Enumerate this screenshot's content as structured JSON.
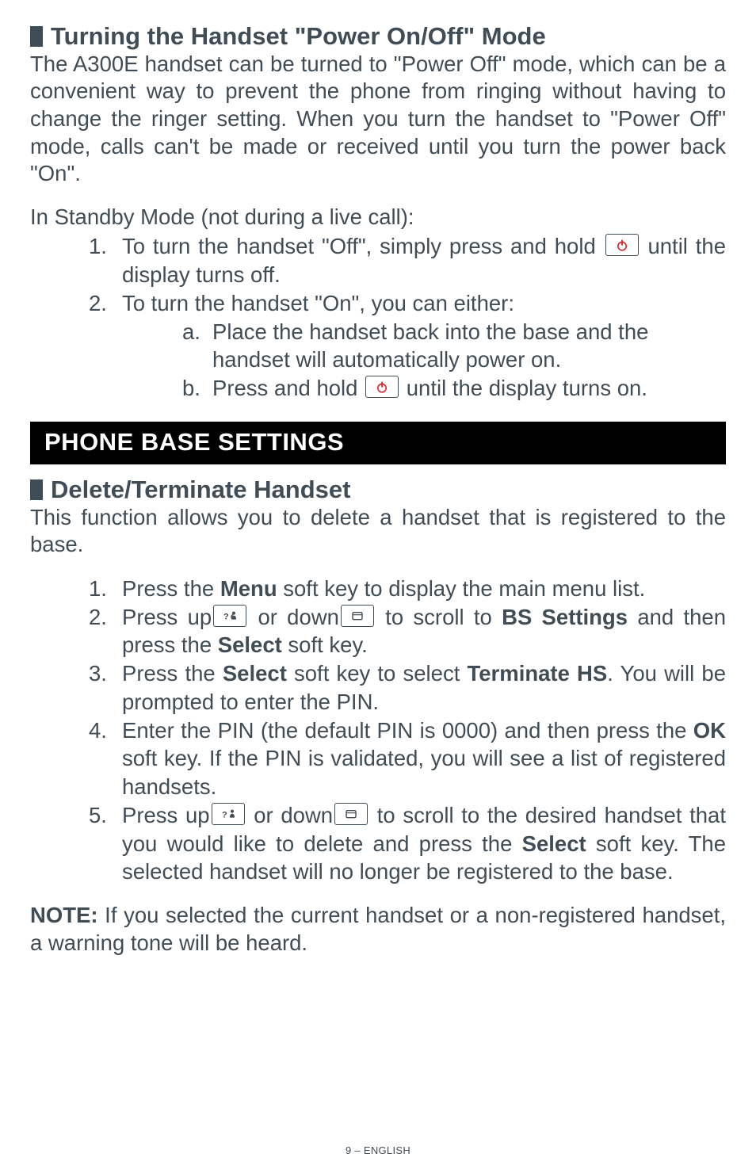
{
  "sec1": {
    "heading": "Turning the Handset \"Power On/Off\" Mode",
    "intro": "The A300E handset can be turned to \"Power Off\" mode, which can be a convenient way to prevent the phone from ringing without having to change the ringer setting.  When you turn the handset to \"Power Off\" mode, calls can't be made or received until you turn the power back \"On\".",
    "standby": "In Standby Mode (not during a live call):",
    "item1_num": "1.",
    "item1_pre": "To turn the handset \"Off\", simply press and hold ",
    "item1_post": " until the display turns off.",
    "item2_num": "2.",
    "item2_text": "To turn the handset \"On\", you can either:",
    "item2a_num": "a.",
    "item2a_text": "Place the handset back into the base and the handset will automatically power on.",
    "item2b_num": "b.",
    "item2b_pre": "Press and hold ",
    "item2b_post": " until the display turns on."
  },
  "bar": "PHONE BASE SETTINGS",
  "sec2": {
    "heading": "Delete/Terminate Handset",
    "intro": "This function allows you to delete a handset that is registered to the base.",
    "s1_num": "1.",
    "s1_a": "Press the ",
    "s1_b": "Menu",
    "s1_c": " soft key to display the main menu list.",
    "s2_num": "2.",
    "s2_a": "Press up",
    "s2_b": " or down",
    "s2_c": " to scroll to ",
    "s2_d": "BS Settings",
    "s2_e": " and then press the ",
    "s2_f": "Select",
    "s2_g": " soft key.",
    "s3_num": "3.",
    "s3_a": "Press the ",
    "s3_b": "Select",
    "s3_c": " soft key to select ",
    "s3_d": "Terminate HS",
    "s3_e": ".  You will be prompted to enter the PIN.",
    "s4_num": "4.",
    "s4_a": "Enter the PIN (the default PIN is 0000) and then press the ",
    "s4_b": "OK",
    "s4_c": " soft key.  If the PIN is validated, you will see a list of registered handsets.",
    "s5_num": "5.",
    "s5_a": "Press up",
    "s5_b": " or down",
    "s5_c": " to scroll to the desired handset that you would like to delete and press the ",
    "s5_d": "Select",
    "s5_e": " soft key.  The selected handset will no longer be registered to the base.",
    "note_label": "NOTE:",
    "note_text": " If you selected the current handset or a non-registered handset, a warning tone will be heard."
  },
  "footer": "9 – ENGLISH",
  "icons": {
    "power": "power-icon",
    "up": "up-icon",
    "down": "down-icon"
  }
}
